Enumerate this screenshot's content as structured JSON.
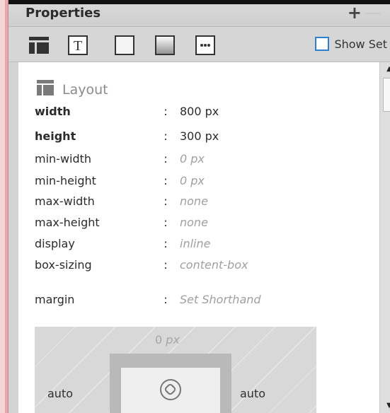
{
  "panel": {
    "title": "Properties",
    "add_label": "+",
    "remove_label": "—"
  },
  "toolbar": {
    "buttons": [
      {
        "icon": "layout-icon"
      },
      {
        "icon": "text-icon"
      },
      {
        "icon": "border-icon"
      },
      {
        "icon": "background-icon"
      },
      {
        "icon": "more-icon"
      }
    ],
    "show_set_label": "Show Set"
  },
  "section": {
    "icon": "layout-section-icon",
    "title": "Layout"
  },
  "properties": [
    {
      "name": "width",
      "value": "800 px"
    },
    {
      "name": "height",
      "value": "300 px"
    },
    {
      "name": "min-width",
      "value": "0 px"
    },
    {
      "name": "min-height",
      "value": "0 px"
    },
    {
      "name": "max-width",
      "value": "none"
    },
    {
      "name": "max-height",
      "value": "none"
    },
    {
      "name": "display",
      "value": "inline"
    },
    {
      "name": "box-sizing",
      "value": "content-box"
    },
    {
      "name": "margin",
      "value": "Set Shorthand"
    }
  ],
  "separator": ":",
  "box_model": {
    "top_value": "0",
    "top_unit": "px",
    "left_value": "auto",
    "right_value": "auto"
  },
  "colors": {
    "accent": "#2e7fd0",
    "muted": "#a0a0a0"
  }
}
